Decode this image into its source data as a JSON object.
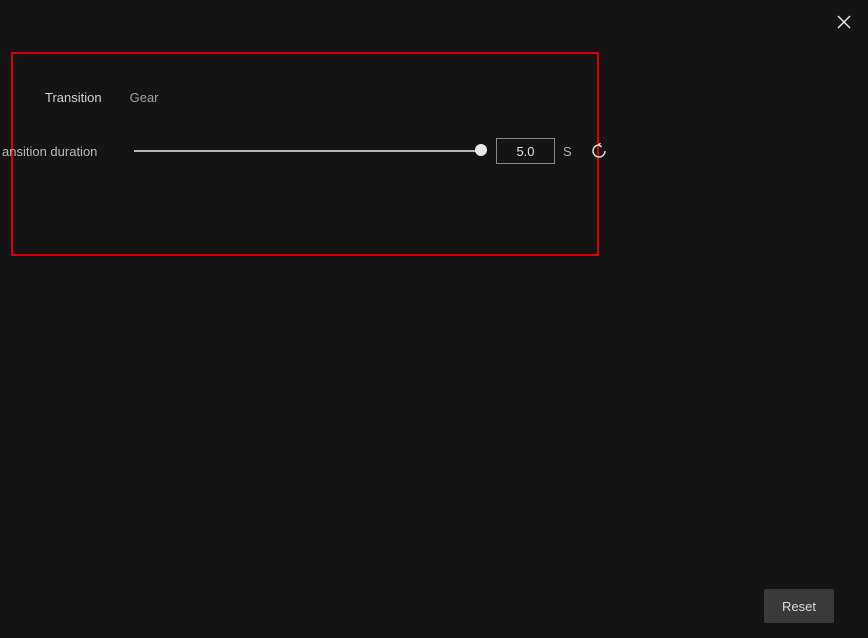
{
  "tabs": {
    "transition": "Transition",
    "gear": "Gear"
  },
  "duration": {
    "label": "ansition duration",
    "value": "5.0",
    "unit": "S"
  },
  "buttons": {
    "reset": "Reset"
  }
}
